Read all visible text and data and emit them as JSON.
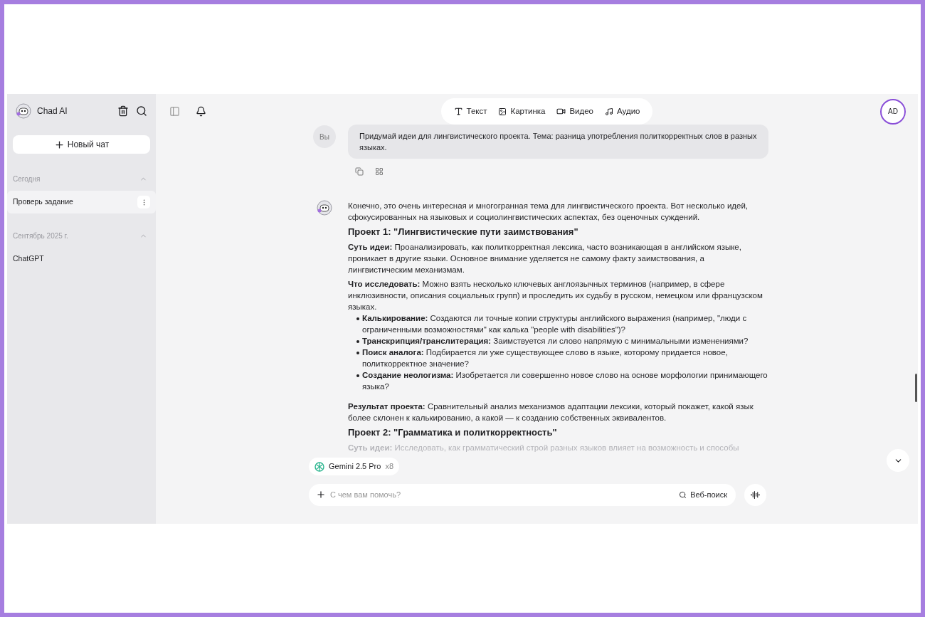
{
  "app": {
    "title": "Chad AI"
  },
  "sidebar": {
    "new_chat": "Новый чат",
    "groups": [
      {
        "label": "Сегодня",
        "expanded": true,
        "items": [
          {
            "label": "Проверь задание",
            "selected": true
          }
        ]
      },
      {
        "label": "Сентябрь 2025 г.",
        "expanded": true,
        "items": [
          {
            "label": "ChatGPT",
            "selected": false
          }
        ]
      }
    ]
  },
  "modes": [
    {
      "kind": "text",
      "label": "Текст"
    },
    {
      "kind": "image",
      "label": "Картинка"
    },
    {
      "kind": "video",
      "label": "Видео"
    },
    {
      "kind": "audio",
      "label": "Аудио"
    }
  ],
  "user_avatar": "AD",
  "user_message": {
    "avatar": "Вы",
    "text": "Придумай идеи для лингвистического проекта. Тема: разница употребления политкорректных слов в разных языках."
  },
  "assistant_message": {
    "blocks": [
      {
        "kind": "paragraph",
        "text": "Конечно, это очень интересная и многогранная тема для лингвистического проекта. Вот несколько идей, сфокусированных на языковых и социолингвистических аспектах, без оценочных суждений.",
        "faded": false
      },
      {
        "kind": "heading",
        "text": "Проект 1: \"Лингвистические пути заимствования\"",
        "faded": false
      },
      {
        "kind": "paragraph",
        "text": "**Суть идеи:** Проанализировать, как политкорректная лексика, часто возникающая в английском языке, проникает в другие языки. Основное внимание уделяется не самому факту заимствования, а лингвистическим механизмам.",
        "faded": false
      },
      {
        "kind": "paragraph",
        "text": "**Что исследовать:** Можно взять несколько ключевых англоязычных терминов (например, в сфере инклюзивности, описания социальных групп) и проследить их судьбу в русском, немецком или французском языках.",
        "faded": false
      },
      {
        "kind": "bullets",
        "faded": false,
        "items": [
          "**Калькирование:** Создаются ли точные копии структуры английского выражения (например, \"люди с ограниченными возможностями\" как калька \"people with disabilities\")?",
          "**Транскрипция/транслитерация:** Заимствуется ли слово напрямую с минимальными изменениями?",
          "**Поиск аналога:** Подбирается ли уже существующее слово в языке, которому придается новое, политкорректное значение?",
          "**Создание неологизма:** Изобретается ли совершенно новое слово на основе морфологии принимающего языка?"
        ]
      },
      {
        "kind": "paragraph",
        "text": "**Результат проекта:** Сравнительный анализ механизмов адаптации лексики, который покажет, какой язык более склонен к калькированию, а какой — к созданию собственных эквивалентов.",
        "faded": false
      },
      {
        "kind": "heading",
        "text": "Проект 2: \"Грамматика и политкорректность\"",
        "faded": false
      },
      {
        "kind": "paragraph",
        "text": "**Суть идеи:** Исследовать, как грамматический строй разных языков влияет на возможность и способы",
        "faded": true
      }
    ]
  },
  "composer": {
    "model": "Gemini 2.5 Pro",
    "model_count": "x8",
    "placeholder": "С чем вам помочь?",
    "web_search": "Веб-поиск"
  }
}
